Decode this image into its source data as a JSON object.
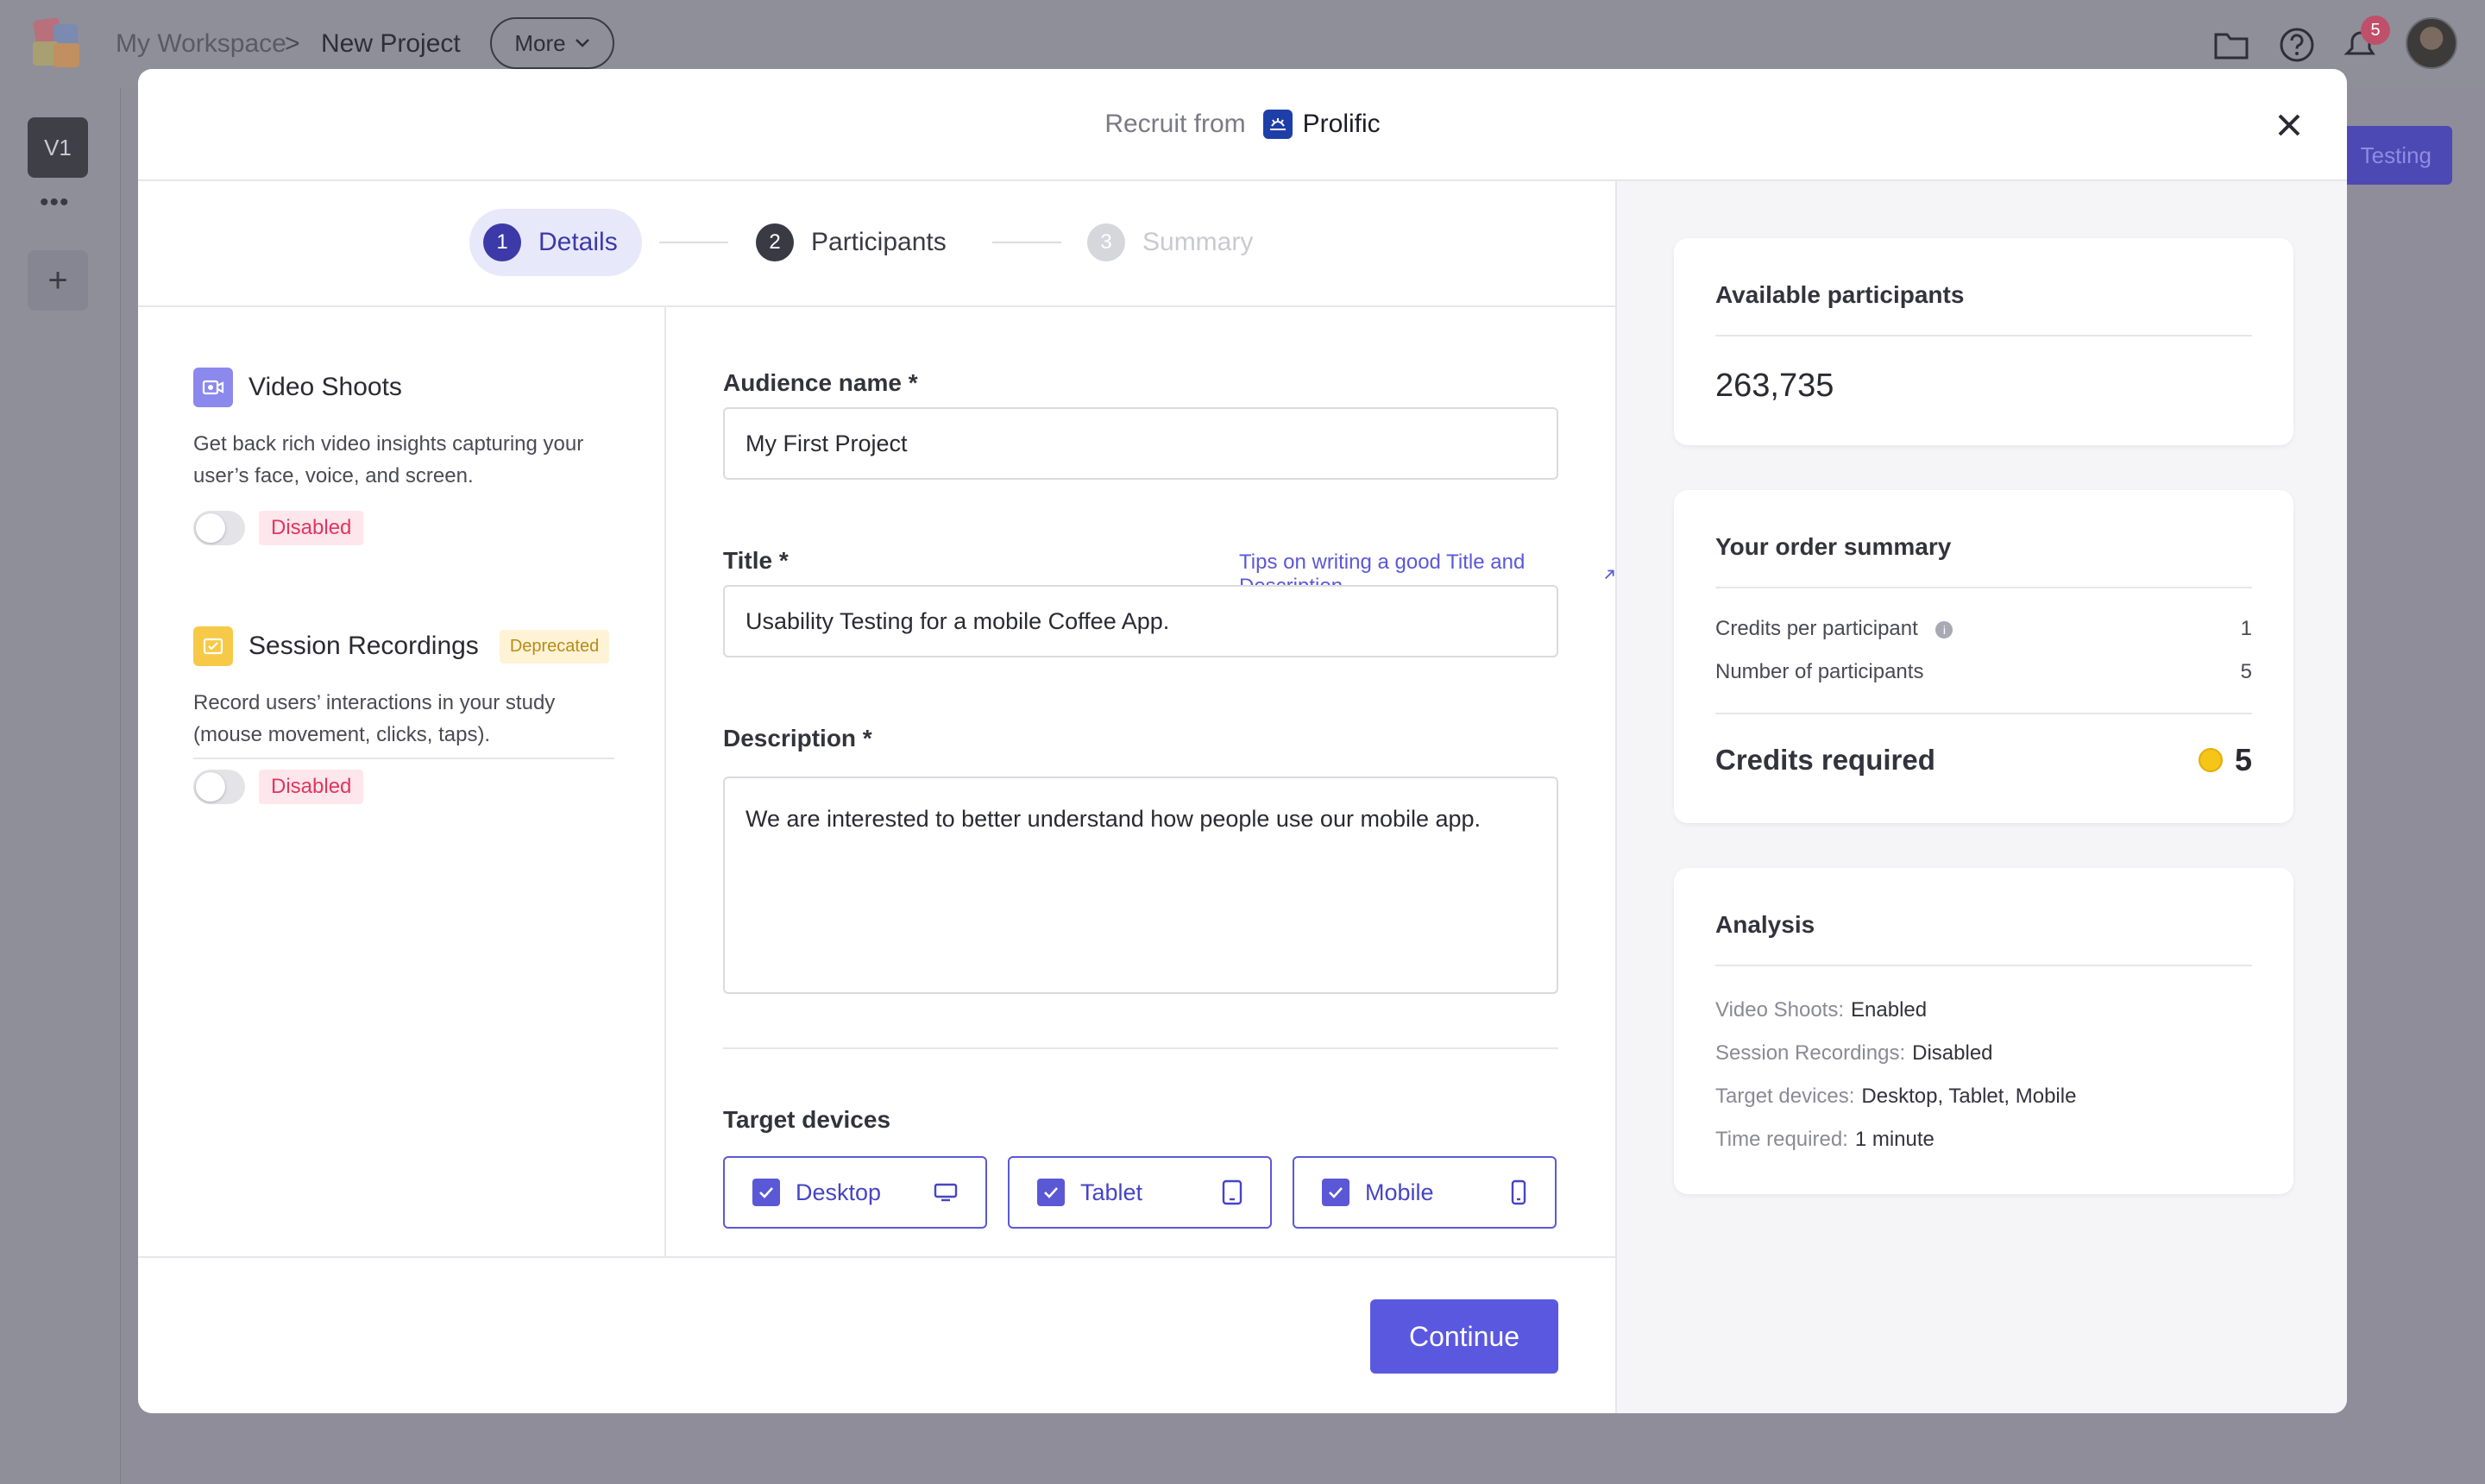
{
  "background": {
    "breadcrumb": {
      "workspace": "My Workspace",
      "separator": ">",
      "project": "New Project"
    },
    "more_label": "More",
    "notification_count": "5",
    "version_label": "V1",
    "version_menu": "•••",
    "add_version": "+",
    "cta_label": "Testing"
  },
  "modal": {
    "header": {
      "recruit_label": "Recruit from",
      "provider": "Prolific"
    },
    "steps": [
      {
        "number": "1",
        "label": "Details",
        "state": "active"
      },
      {
        "number": "2",
        "label": "Participants",
        "state": "upcoming"
      },
      {
        "number": "3",
        "label": "Summary",
        "state": "disabled"
      }
    ],
    "features": [
      {
        "title": "Video Shoots",
        "description": "Get back rich video insights capturing your user’s face, voice, and screen.",
        "status": "Disabled",
        "icon": "video-camera-icon"
      },
      {
        "title": "Session Recordings",
        "tag": "Deprecated",
        "description": "Record users’ interactions in your study (mouse movement, clicks, taps).",
        "status": "Disabled",
        "icon": "recording-icon"
      }
    ],
    "form": {
      "audience_label": "Audience name *",
      "audience_value": "My First Project",
      "title_label": "Title *",
      "tips_link": "Tips on writing a good Title and Description",
      "title_value": "Usability Testing for a mobile Coffee App.",
      "description_label": "Description *",
      "description_value": "We are interested to better understand how people use our mobile app.",
      "devices_label": "Target devices",
      "devices": [
        {
          "label": "Desktop",
          "checked": true,
          "icon": "desktop-icon"
        },
        {
          "label": "Tablet",
          "checked": true,
          "icon": "tablet-icon"
        },
        {
          "label": "Mobile",
          "checked": true,
          "icon": "mobile-icon"
        }
      ]
    },
    "continue_label": "Continue",
    "sidebar": {
      "available": {
        "title": "Available participants",
        "value": "263,735"
      },
      "order": {
        "title": "Your order summary",
        "rows": [
          {
            "label": "Credits per participant",
            "value": "1",
            "info": true
          },
          {
            "label": "Number of participants",
            "value": "5"
          }
        ],
        "credits_label": "Credits required",
        "credits_value": "5"
      },
      "analysis": {
        "title": "Analysis",
        "rows": [
          {
            "key": "Video Shoots:",
            "value": "Enabled"
          },
          {
            "key": "Session Recordings:",
            "value": "Disabled"
          },
          {
            "key": "Target devices:",
            "value": "Desktop, Tablet, Mobile"
          },
          {
            "key": "Time required:",
            "value": "1 minute"
          }
        ]
      }
    }
  },
  "colors": {
    "accent": "#5b58e0",
    "step_active_bg": "#e8e8fb",
    "disabled_badge": "#e0365f",
    "deprecated_badge": "#b98b16",
    "coin": "#f5c518"
  }
}
